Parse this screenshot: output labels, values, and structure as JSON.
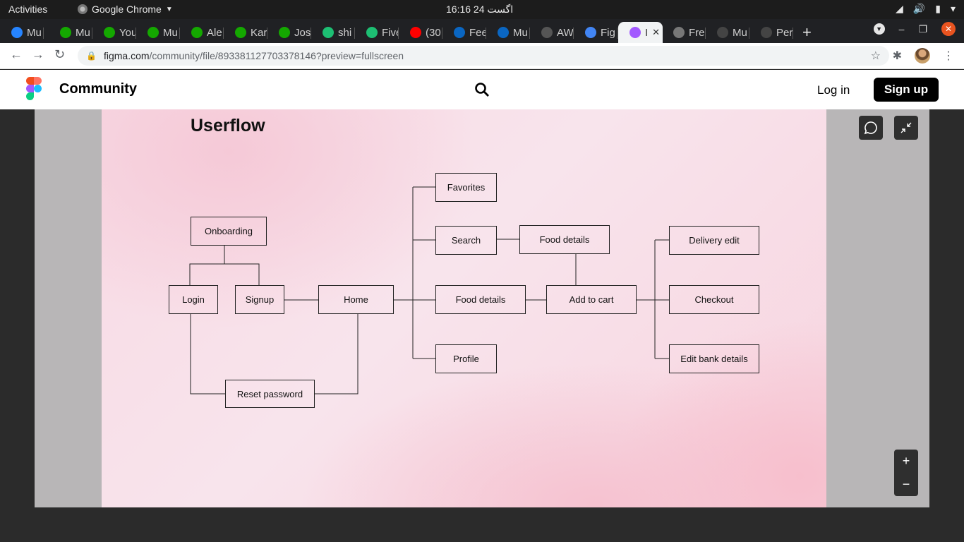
{
  "os_bar": {
    "activities": "Activities",
    "app_name": "Google Chrome",
    "clock": "16:16  24 اگست"
  },
  "tabs": [
    {
      "label": "Mu",
      "icon": "jira-icon",
      "color": "#2684ff"
    },
    {
      "label": "Mu",
      "icon": "upwork-icon",
      "color": "#14a800"
    },
    {
      "label": "You",
      "icon": "upwork-icon",
      "color": "#14a800"
    },
    {
      "label": "Mu",
      "icon": "upwork-icon",
      "color": "#14a800"
    },
    {
      "label": "Ale",
      "icon": "upwork-icon",
      "color": "#14a800"
    },
    {
      "label": "Kar",
      "icon": "upwork-icon",
      "color": "#14a800"
    },
    {
      "label": "Jos",
      "icon": "upwork-icon",
      "color": "#14a800"
    },
    {
      "label": "shi",
      "icon": "fiverr-icon",
      "color": "#1dbf73"
    },
    {
      "label": "Five",
      "icon": "fiverr-icon",
      "color": "#1dbf73"
    },
    {
      "label": "(30",
      "icon": "youtube-icon",
      "color": "#ff0000"
    },
    {
      "label": "Fee",
      "icon": "linkedin-icon",
      "color": "#0a66c2"
    },
    {
      "label": "Mu",
      "icon": "linkedin-icon",
      "color": "#0a66c2"
    },
    {
      "label": "AW",
      "icon": "aw-icon",
      "color": "#555555"
    },
    {
      "label": "Fig",
      "icon": "google-icon",
      "color": "#4285f4"
    },
    {
      "label": "I",
      "icon": "figma-icon",
      "color": "#a259ff",
      "active": true
    },
    {
      "label": "Fre",
      "icon": "globe-icon",
      "color": "#777777"
    },
    {
      "label": "Mu",
      "icon": "github-icon",
      "color": "#444444"
    },
    {
      "label": "Per",
      "icon": "github-icon",
      "color": "#444444"
    }
  ],
  "address": {
    "domain": "figma.com",
    "path": "/community/file/893381127703378146?preview=fullscreen"
  },
  "header": {
    "brand": "Community",
    "login": "Log in",
    "signup": "Sign up"
  },
  "flow": {
    "title": "Userflow",
    "nodes": {
      "onboarding": "Onboarding",
      "login": "Login",
      "signup": "Signup",
      "home": "Home",
      "reset_password": "Reset password",
      "favorites": "Favorites",
      "search": "Search",
      "food_details_top": "Food details",
      "food_details_mid": "Food details",
      "add_to_cart": "Add to cart",
      "profile": "Profile",
      "delivery_edit": "Delivery edit",
      "checkout": "Checkout",
      "edit_bank_details": "Edit bank details"
    }
  },
  "controls": {
    "zoom_in": "+",
    "zoom_out": "−"
  }
}
